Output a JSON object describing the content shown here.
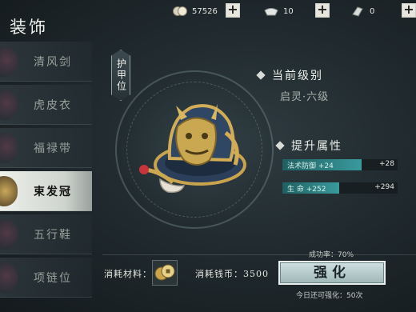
{
  "header": {
    "title": "装饰",
    "resources": [
      {
        "icon": "coin-icon",
        "value": "57526"
      },
      {
        "icon": "silver-ingot-icon",
        "value": "10"
      },
      {
        "icon": "jade-icon",
        "value": "0"
      }
    ]
  },
  "sidebar": {
    "items": [
      {
        "label": "清风剑"
      },
      {
        "label": "虎皮衣"
      },
      {
        "label": "福禄带"
      },
      {
        "label": "束发冠"
      },
      {
        "label": "五行鞋"
      },
      {
        "label": "项链位"
      }
    ],
    "selected_index": 3
  },
  "slot": {
    "label": "护甲位"
  },
  "current_level": {
    "heading": "当前级别",
    "value": "启灵·六级"
  },
  "upgrade_attrs": {
    "heading": "提升属性",
    "stats": [
      {
        "text": "法术防御 +24",
        "next": "+28",
        "fill": 0.69
      },
      {
        "text": "生  命 +252",
        "next": "+294",
        "fill": 0.49
      }
    ]
  },
  "cost": {
    "material_label": "消耗材料：",
    "coins_label": "消耗钱币：",
    "coins_value": "3500"
  },
  "success_rate": "成功率：70%",
  "upgrade_button": "强化",
  "remaining": "今日还可强化：50次",
  "colors": {
    "accent": "#3a9a9c",
    "button": "#b8cccc"
  }
}
